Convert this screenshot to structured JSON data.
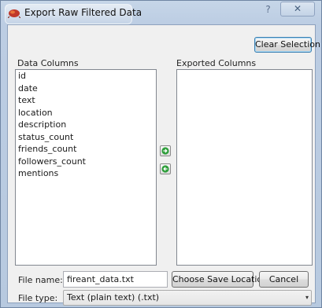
{
  "window": {
    "title": "Export Raw Filtered Data",
    "help_glyph": "?",
    "close_glyph": "✕"
  },
  "toolbar": {
    "clear_selection_label": "Clear Selection"
  },
  "data_columns": {
    "label": "Data Columns",
    "items": [
      "id",
      "date",
      "text",
      "location",
      "description",
      "status_count",
      "friends_count",
      "followers_count",
      "mentions"
    ]
  },
  "exported_columns": {
    "label": "Exported Columns",
    "items": []
  },
  "file": {
    "name_label": "File name:",
    "name_value": "fireant_data.txt",
    "type_label": "File type:",
    "type_value": "Text (plain text) (.txt)"
  },
  "buttons": {
    "choose_save_location": "Choose Save Location",
    "cancel": "Cancel"
  },
  "icons": {
    "app": "fireant-app-icon",
    "add": "arrow-right-icon",
    "remove": "arrow-left-icon"
  },
  "colors": {
    "arrow_green": "#2e9e3a",
    "title_bar": "#bccde3"
  }
}
